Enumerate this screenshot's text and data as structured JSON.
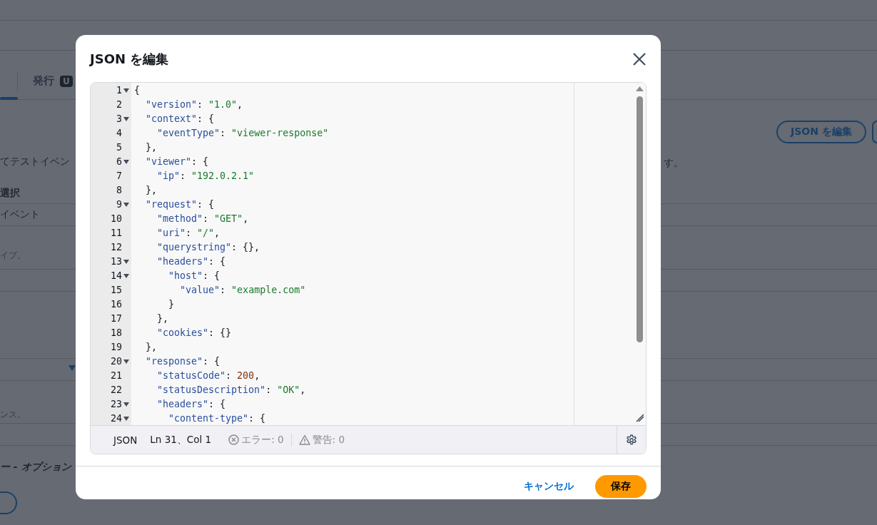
{
  "background": {
    "tabs": [
      {
        "label": "発行",
        "badge": "U",
        "selected": false
      }
    ],
    "texts": [
      "てテストイベン",
      "選択",
      "イベント",
      "イプ。",
      "ンス。",
      "ー - オプション",
      "す。"
    ],
    "edit_json_button": "JSON を編集"
  },
  "dialog": {
    "title": "JSON を編集",
    "lines": [
      {
        "number": "1",
        "foldable": true,
        "tokens": [
          {
            "kind": "punct",
            "text": "{"
          }
        ]
      },
      {
        "number": "2",
        "foldable": false,
        "tokens": [
          {
            "kind": "key",
            "text": "  \"version\""
          },
          {
            "kind": "punct",
            "text": ": "
          },
          {
            "kind": "string",
            "text": "\"1.0\""
          },
          {
            "kind": "punct",
            "text": ","
          }
        ]
      },
      {
        "number": "3",
        "foldable": true,
        "tokens": [
          {
            "kind": "key",
            "text": "  \"context\""
          },
          {
            "kind": "punct",
            "text": ": {"
          }
        ]
      },
      {
        "number": "4",
        "foldable": false,
        "tokens": [
          {
            "kind": "key",
            "text": "    \"eventType\""
          },
          {
            "kind": "punct",
            "text": ": "
          },
          {
            "kind": "string",
            "text": "\"viewer-response\""
          }
        ]
      },
      {
        "number": "5",
        "foldable": false,
        "tokens": [
          {
            "kind": "punct",
            "text": "  },"
          }
        ]
      },
      {
        "number": "6",
        "foldable": true,
        "tokens": [
          {
            "kind": "key",
            "text": "  \"viewer\""
          },
          {
            "kind": "punct",
            "text": ": {"
          }
        ]
      },
      {
        "number": "7",
        "foldable": false,
        "tokens": [
          {
            "kind": "key",
            "text": "    \"ip\""
          },
          {
            "kind": "punct",
            "text": ": "
          },
          {
            "kind": "string",
            "text": "\"192.0.2.1\""
          }
        ]
      },
      {
        "number": "8",
        "foldable": false,
        "tokens": [
          {
            "kind": "punct",
            "text": "  },"
          }
        ]
      },
      {
        "number": "9",
        "foldable": true,
        "tokens": [
          {
            "kind": "key",
            "text": "  \"request\""
          },
          {
            "kind": "punct",
            "text": ": {"
          }
        ]
      },
      {
        "number": "10",
        "foldable": false,
        "tokens": [
          {
            "kind": "key",
            "text": "    \"method\""
          },
          {
            "kind": "punct",
            "text": ": "
          },
          {
            "kind": "string",
            "text": "\"GET\""
          },
          {
            "kind": "punct",
            "text": ","
          }
        ]
      },
      {
        "number": "11",
        "foldable": false,
        "tokens": [
          {
            "kind": "key",
            "text": "    \"uri\""
          },
          {
            "kind": "punct",
            "text": ": "
          },
          {
            "kind": "string",
            "text": "\"/\""
          },
          {
            "kind": "punct",
            "text": ","
          }
        ]
      },
      {
        "number": "12",
        "foldable": false,
        "tokens": [
          {
            "kind": "key",
            "text": "    \"querystring\""
          },
          {
            "kind": "punct",
            "text": ": {},"
          }
        ]
      },
      {
        "number": "13",
        "foldable": true,
        "tokens": [
          {
            "kind": "key",
            "text": "    \"headers\""
          },
          {
            "kind": "punct",
            "text": ": {"
          }
        ]
      },
      {
        "number": "14",
        "foldable": true,
        "tokens": [
          {
            "kind": "key",
            "text": "      \"host\""
          },
          {
            "kind": "punct",
            "text": ": {"
          }
        ]
      },
      {
        "number": "15",
        "foldable": false,
        "tokens": [
          {
            "kind": "key",
            "text": "        \"value\""
          },
          {
            "kind": "punct",
            "text": ": "
          },
          {
            "kind": "string",
            "text": "\"example.com\""
          }
        ]
      },
      {
        "number": "16",
        "foldable": false,
        "tokens": [
          {
            "kind": "punct",
            "text": "      }"
          }
        ]
      },
      {
        "number": "17",
        "foldable": false,
        "tokens": [
          {
            "kind": "punct",
            "text": "    },"
          }
        ]
      },
      {
        "number": "18",
        "foldable": false,
        "tokens": [
          {
            "kind": "key",
            "text": "    \"cookies\""
          },
          {
            "kind": "punct",
            "text": ": {}"
          }
        ]
      },
      {
        "number": "19",
        "foldable": false,
        "tokens": [
          {
            "kind": "punct",
            "text": "  },"
          }
        ]
      },
      {
        "number": "20",
        "foldable": true,
        "tokens": [
          {
            "kind": "key",
            "text": "  \"response\""
          },
          {
            "kind": "punct",
            "text": ": {"
          }
        ]
      },
      {
        "number": "21",
        "foldable": false,
        "tokens": [
          {
            "kind": "key",
            "text": "    \"statusCode\""
          },
          {
            "kind": "punct",
            "text": ": "
          },
          {
            "kind": "number",
            "text": "200"
          },
          {
            "kind": "punct",
            "text": ","
          }
        ]
      },
      {
        "number": "22",
        "foldable": false,
        "tokens": [
          {
            "kind": "key",
            "text": "    \"statusDescription\""
          },
          {
            "kind": "punct",
            "text": ": "
          },
          {
            "kind": "string",
            "text": "\"OK\""
          },
          {
            "kind": "punct",
            "text": ","
          }
        ]
      },
      {
        "number": "23",
        "foldable": true,
        "tokens": [
          {
            "kind": "key",
            "text": "    \"headers\""
          },
          {
            "kind": "punct",
            "text": ": {"
          }
        ]
      },
      {
        "number": "24",
        "foldable": true,
        "tokens": [
          {
            "kind": "key",
            "text": "      \"content-type\""
          },
          {
            "kind": "punct",
            "text": ": {"
          }
        ]
      }
    ],
    "status_bar": {
      "mode": "JSON",
      "position": "Ln 31、Col 1",
      "errors": "エラー: 0",
      "warnings": "警告: 0"
    },
    "buttons": [
      {
        "kind": "link",
        "label": "キャンセル"
      },
      {
        "kind": "primary",
        "label": "保存"
      }
    ]
  }
}
